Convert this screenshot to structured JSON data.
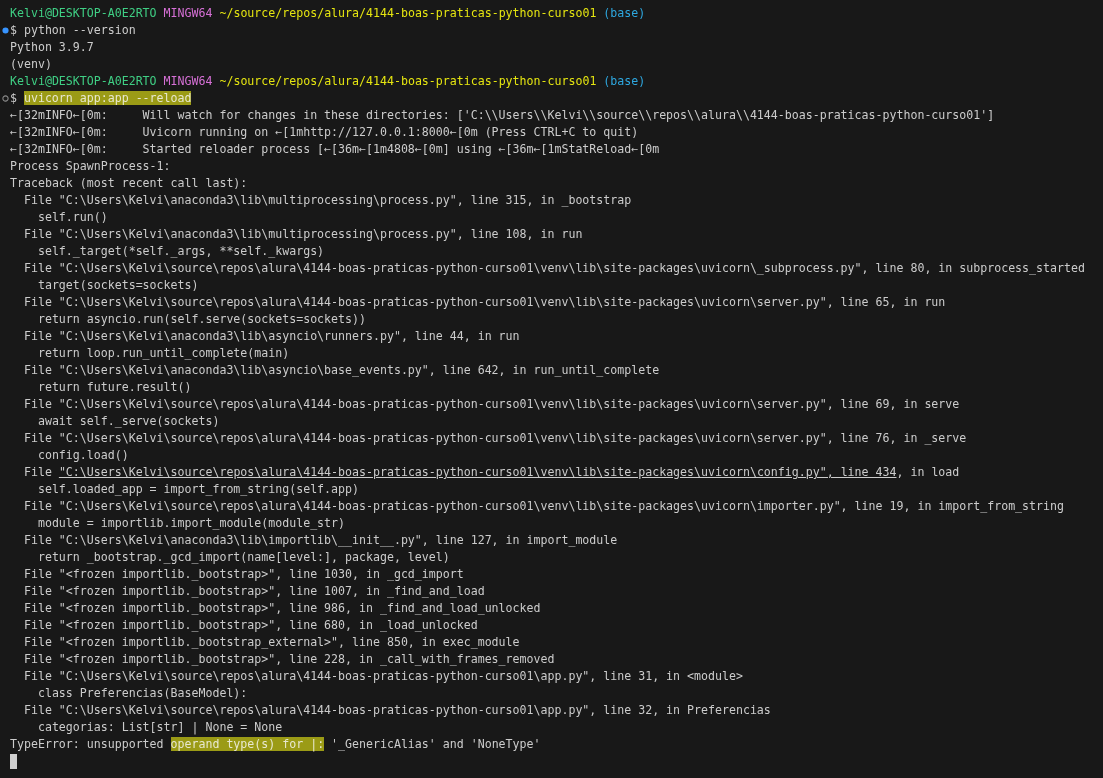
{
  "lines": [
    {
      "kind": "prompt",
      "user": "Kelvi@DESKTOP-A0E2RTO",
      "shell": "MINGW64",
      "path": "~/source/repos/alura/4144-boas-praticas-python-curso01",
      "env": "(base)"
    },
    {
      "kind": "command",
      "succeeded": true,
      "symbol": "$",
      "text": "python --version",
      "highlighted": false
    },
    {
      "kind": "output",
      "text": "Python 3.9.7"
    },
    {
      "kind": "output",
      "text": "(venv)"
    },
    {
      "kind": "prompt",
      "user": "Kelvi@DESKTOP-A0E2RTO",
      "shell": "MINGW64",
      "path": "~/source/repos/alura/4144-boas-praticas-python-curso01",
      "env": "(base)"
    },
    {
      "kind": "command",
      "succeeded": false,
      "symbol": "$",
      "text": "uvicorn app:app --reload",
      "highlighted": true
    },
    {
      "kind": "output",
      "text": "←[32mINFO←[0m:     Will watch for changes in these directories: ['C:\\\\Users\\\\Kelvi\\\\source\\\\repos\\\\alura\\\\4144-boas-praticas-python-curso01']"
    },
    {
      "kind": "output",
      "text": "←[32mINFO←[0m:     Uvicorn running on ←[1mhttp://127.0.0.1:8000←[0m (Press CTRL+C to quit)"
    },
    {
      "kind": "output",
      "text": "←[32mINFO←[0m:     Started reloader process [←[36m←[1m4808←[0m] using ←[36m←[1mStatReload←[0m"
    },
    {
      "kind": "output",
      "text": "Process SpawnProcess-1:"
    },
    {
      "kind": "output",
      "text": "Traceback (most recent call last):"
    },
    {
      "kind": "output",
      "text": "  File \"C:\\Users\\Kelvi\\anaconda3\\lib\\multiprocessing\\process.py\", line 315, in _bootstrap"
    },
    {
      "kind": "output",
      "text": "    self.run()"
    },
    {
      "kind": "output",
      "text": "  File \"C:\\Users\\Kelvi\\anaconda3\\lib\\multiprocessing\\process.py\", line 108, in run"
    },
    {
      "kind": "output",
      "text": "    self._target(*self._args, **self._kwargs)"
    },
    {
      "kind": "output",
      "text": "  File \"C:\\Users\\Kelvi\\source\\repos\\alura\\4144-boas-praticas-python-curso01\\venv\\lib\\site-packages\\uvicorn\\_subprocess.py\", line 80, in subprocess_started"
    },
    {
      "kind": "output",
      "text": "    target(sockets=sockets)"
    },
    {
      "kind": "output",
      "text": "  File \"C:\\Users\\Kelvi\\source\\repos\\alura\\4144-boas-praticas-python-curso01\\venv\\lib\\site-packages\\uvicorn\\server.py\", line 65, in run"
    },
    {
      "kind": "output",
      "text": "    return asyncio.run(self.serve(sockets=sockets))"
    },
    {
      "kind": "output",
      "text": "  File \"C:\\Users\\Kelvi\\anaconda3\\lib\\asyncio\\runners.py\", line 44, in run"
    },
    {
      "kind": "output",
      "text": "    return loop.run_until_complete(main)"
    },
    {
      "kind": "output",
      "text": "  File \"C:\\Users\\Kelvi\\anaconda3\\lib\\asyncio\\base_events.py\", line 642, in run_until_complete"
    },
    {
      "kind": "output",
      "text": "    return future.result()"
    },
    {
      "kind": "output",
      "text": "  File \"C:\\Users\\Kelvi\\source\\repos\\alura\\4144-boas-praticas-python-curso01\\venv\\lib\\site-packages\\uvicorn\\server.py\", line 69, in serve"
    },
    {
      "kind": "output",
      "text": "    await self._serve(sockets)"
    },
    {
      "kind": "output",
      "text": "  File \"C:\\Users\\Kelvi\\source\\repos\\alura\\4144-boas-praticas-python-curso01\\venv\\lib\\site-packages\\uvicorn\\server.py\", line 76, in _serve"
    },
    {
      "kind": "output",
      "text": "    config.load()"
    },
    {
      "kind": "output",
      "parts": [
        {
          "kind": "plain",
          "text": "  File "
        },
        {
          "kind": "link",
          "text": "\"C:\\Users\\Kelvi\\source\\repos\\alura\\4144-boas-praticas-python-curso01\\venv\\lib\\site-packages\\uvicorn\\config.py\", line 434"
        },
        {
          "kind": "plain",
          "text": ", in load"
        }
      ]
    },
    {
      "kind": "output",
      "text": "    self.loaded_app = import_from_string(self.app)"
    },
    {
      "kind": "output",
      "text": "  File \"C:\\Users\\Kelvi\\source\\repos\\alura\\4144-boas-praticas-python-curso01\\venv\\lib\\site-packages\\uvicorn\\importer.py\", line 19, in import_from_string"
    },
    {
      "kind": "output",
      "text": "    module = importlib.import_module(module_str)"
    },
    {
      "kind": "output",
      "text": "  File \"C:\\Users\\Kelvi\\anaconda3\\lib\\importlib\\__init__.py\", line 127, in import_module"
    },
    {
      "kind": "output",
      "text": "    return _bootstrap._gcd_import(name[level:], package, level)"
    },
    {
      "kind": "output",
      "text": "  File \"<frozen importlib._bootstrap>\", line 1030, in _gcd_import"
    },
    {
      "kind": "output",
      "text": "  File \"<frozen importlib._bootstrap>\", line 1007, in _find_and_load"
    },
    {
      "kind": "output",
      "text": "  File \"<frozen importlib._bootstrap>\", line 986, in _find_and_load_unlocked"
    },
    {
      "kind": "output",
      "text": "  File \"<frozen importlib._bootstrap>\", line 680, in _load_unlocked"
    },
    {
      "kind": "output",
      "text": "  File \"<frozen importlib._bootstrap_external>\", line 850, in exec_module"
    },
    {
      "kind": "output",
      "text": "  File \"<frozen importlib._bootstrap>\", line 228, in _call_with_frames_removed"
    },
    {
      "kind": "output",
      "text": "  File \"C:\\Users\\Kelvi\\source\\repos\\alura\\4144-boas-praticas-python-curso01\\app.py\", line 31, in <module>"
    },
    {
      "kind": "output",
      "text": "    class Preferencias(BaseModel):"
    },
    {
      "kind": "output",
      "text": "  File \"C:\\Users\\Kelvi\\source\\repos\\alura\\4144-boas-praticas-python-curso01\\app.py\", line 32, in Preferencias"
    },
    {
      "kind": "output",
      "text": "    categorias: List[str] | None = None"
    },
    {
      "kind": "output",
      "parts": [
        {
          "kind": "plain",
          "text": "TypeError: unsupported "
        },
        {
          "kind": "highlight",
          "text": "operand type(s) for |:"
        },
        {
          "kind": "plain",
          "text": " '_GenericAlias' and 'NoneType'"
        }
      ]
    }
  ]
}
